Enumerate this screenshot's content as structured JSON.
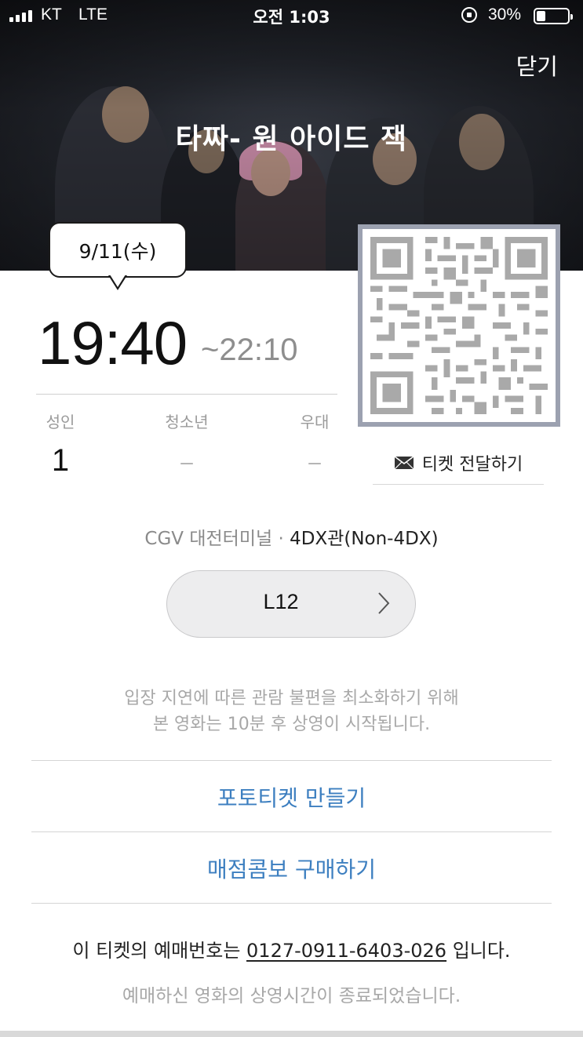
{
  "status_bar": {
    "carrier": "KT",
    "network": "LTE",
    "time": "오전 1:03",
    "battery_percent": "30%",
    "battery_level": 0.3
  },
  "header": {
    "close_label": "닫기",
    "movie_title": "타짜- 원 아이드 잭"
  },
  "showtime": {
    "date": "9/11(수)",
    "start": "19:40",
    "end": "~22:10"
  },
  "audience": [
    {
      "label": "성인",
      "value": "1"
    },
    {
      "label": "청소년",
      "value": "–"
    },
    {
      "label": "우대",
      "value": "–"
    }
  ],
  "qr": {
    "icon": "qr-code-icon"
  },
  "transfer": {
    "label": "티켓 전달하기",
    "icon": "mail-icon"
  },
  "theater": {
    "name": "CGV 대전터미널 · ",
    "hall": "4DX관(Non-4DX)"
  },
  "seat": {
    "label": "L12",
    "icon": "chevron-right-icon"
  },
  "notice": {
    "line1": "입장 지연에 따른 관람 불편을 최소화하기 위해",
    "line2": "본 영화는 10분 후 상영이 시작됩니다."
  },
  "actions": {
    "photo_ticket": "포토티켓 만들기",
    "combo": "매점콤보 구매하기"
  },
  "booking": {
    "prefix": "이 티켓의 예매번호는 ",
    "number": "0127-0911-6403-026",
    "suffix": " 입니다."
  },
  "footer": {
    "ended_text": "예매하신 영화의 상영시간이 종료되었습니다."
  },
  "colors": {
    "link": "#3d7fc0",
    "qr_border": "#9ca1b0",
    "muted": "#a8a8a8"
  }
}
